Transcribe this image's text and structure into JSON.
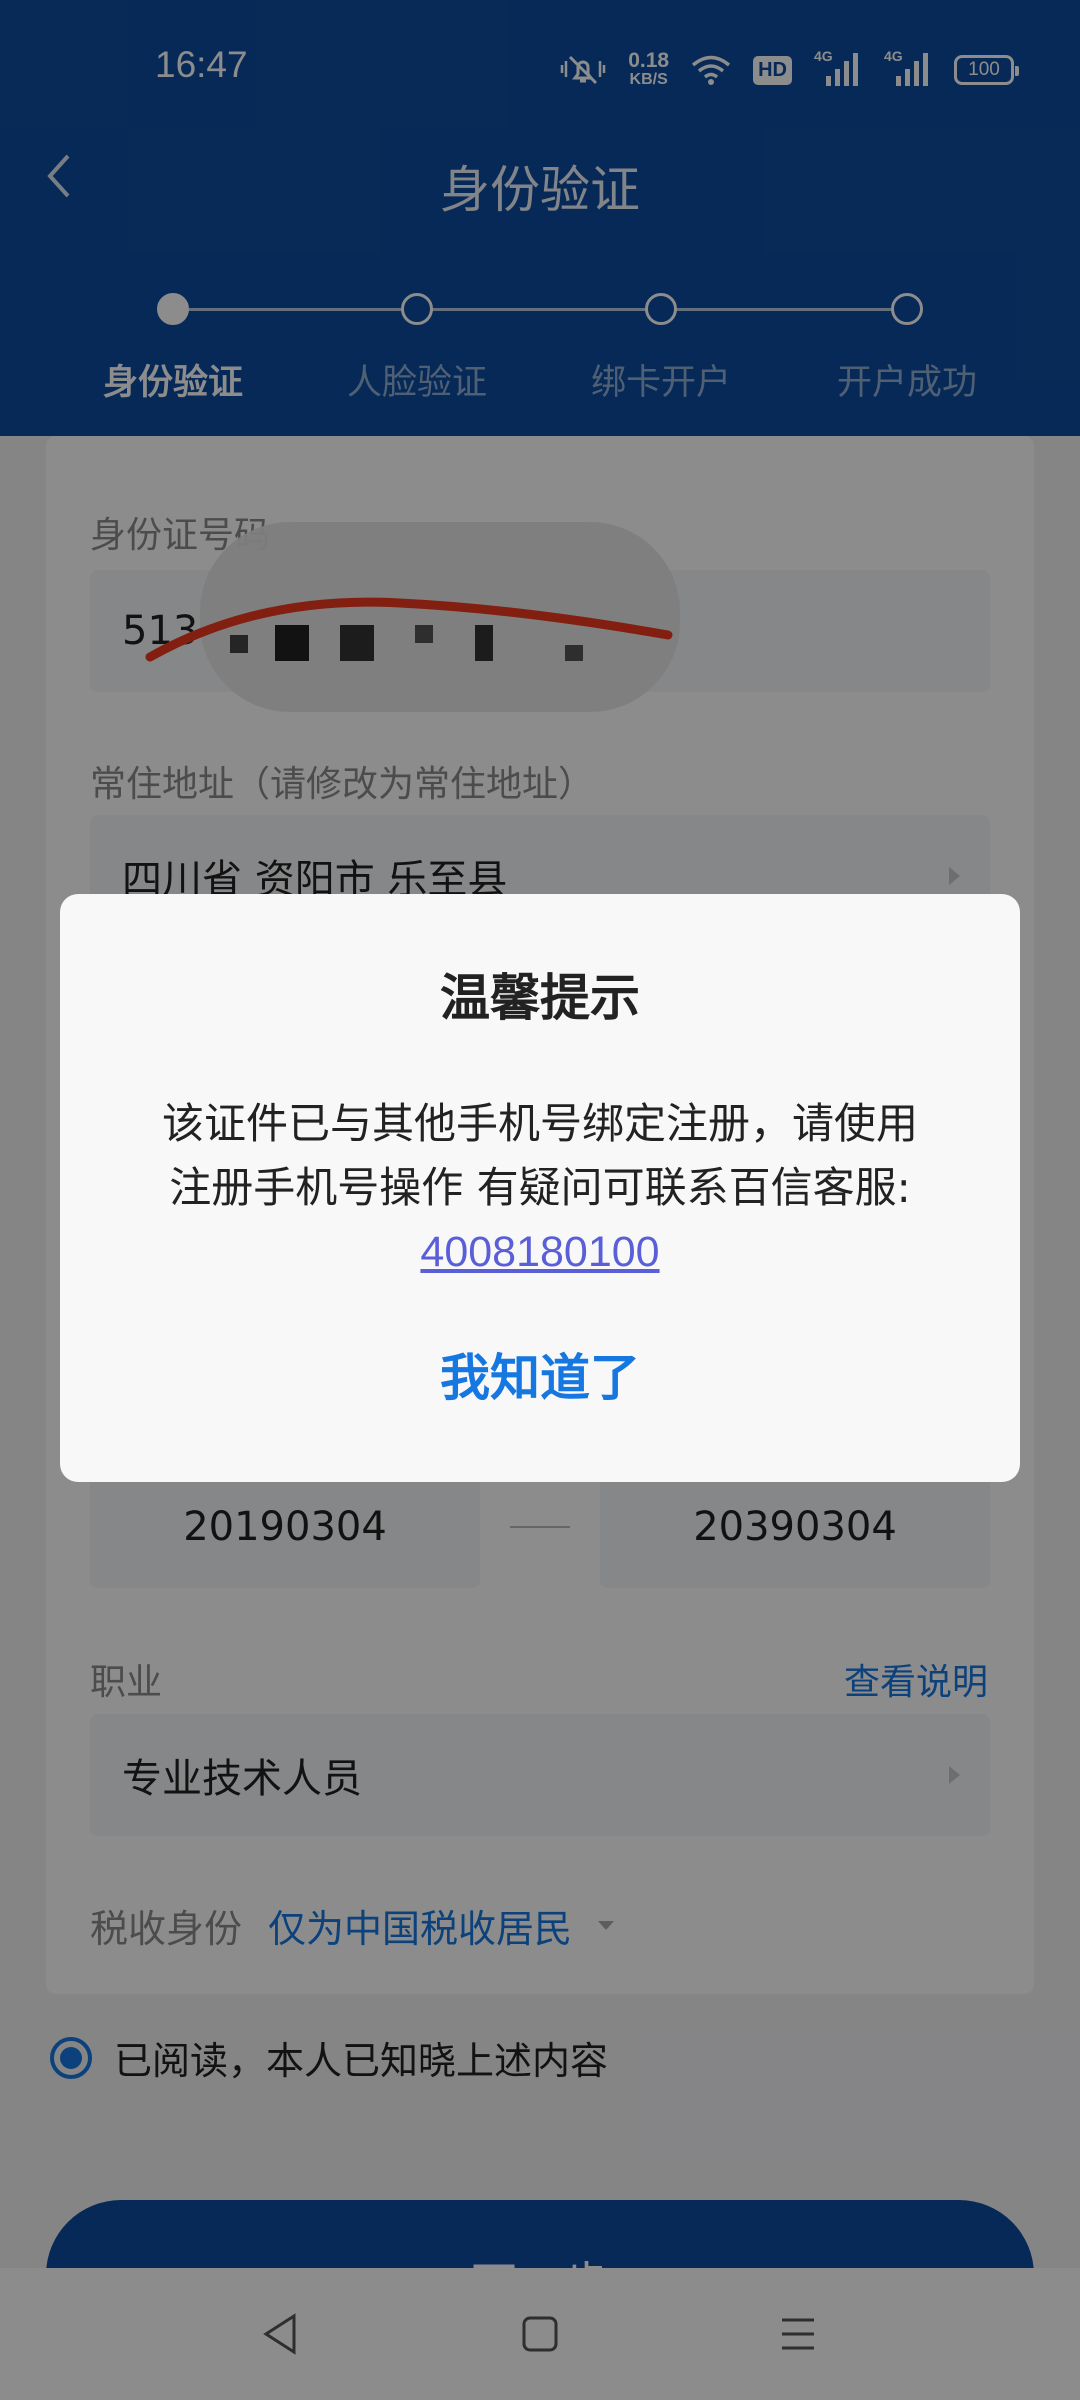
{
  "status_bar": {
    "time": "16:47",
    "net_speed_value": "0.18",
    "net_speed_unit": "KB/S",
    "hd_label": "HD",
    "sim1_label": "4G",
    "sim2_label": "4G",
    "battery": "100"
  },
  "nav": {
    "title": "身份验证"
  },
  "steps": [
    {
      "label": "身份验证",
      "active": true
    },
    {
      "label": "人脸验证",
      "active": false
    },
    {
      "label": "绑卡开户",
      "active": false
    },
    {
      "label": "开户成功",
      "active": false
    }
  ],
  "form": {
    "id_label": "身份证号码",
    "id_value_visible": "513",
    "address_label": "常住地址（请修改为常住地址）",
    "address_value": "四川省 资阳市 乐至县",
    "valid_start": "20190304",
    "valid_end": "20390304",
    "job_label": "职业",
    "job_help_link": "查看说明",
    "job_value": "专业技术人员",
    "tax_label": "税收身份",
    "tax_value": "仅为中国税收居民",
    "agree_text": "已阅读，本人已知晓上述内容",
    "next_button": "下一步"
  },
  "dialog": {
    "title": "温馨提示",
    "message_line1": "该证件已与其他手机号绑定注册，请使用",
    "message_line2": "注册手机号操作 有疑问可联系百信客服:",
    "phone": "4008180100",
    "confirm_button": "我知道了"
  },
  "colors": {
    "brand_blue": "#0c4c9e",
    "link_blue": "#1677e0",
    "phone_link": "#5a5fd8"
  }
}
